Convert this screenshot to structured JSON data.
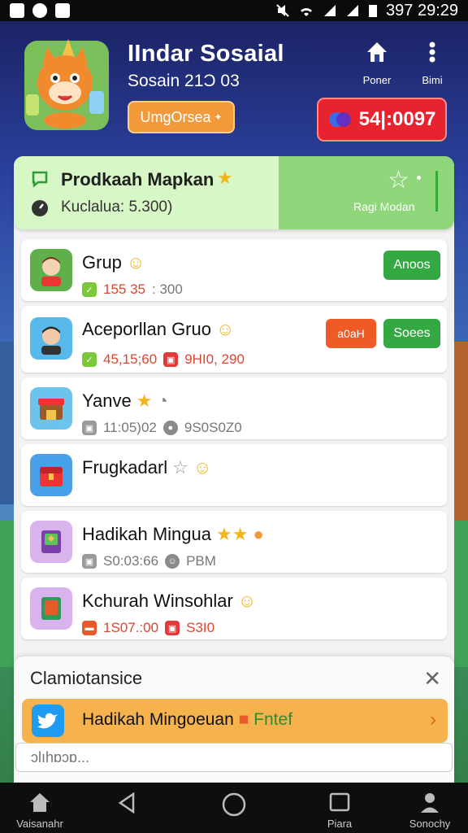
{
  "status_bar": {
    "time": "397 29:29"
  },
  "header": {
    "title": "IIndar Sosaial",
    "subtitle": "Sosain 21Ͻ 03",
    "promo_button": "UmgOrsea",
    "nav_home_label": "Poner",
    "nav_menu_label": "Bimi",
    "score": "54|:0097"
  },
  "featured": {
    "title": "Prodkaah Mapkan",
    "subtitle": "Kuclalua: 5.300)",
    "right_label": "Ragi Modan"
  },
  "rows": [
    {
      "name": "Grup",
      "meta1": "155 35",
      "meta2": ": 300",
      "button": "Anoos",
      "button2": ""
    },
    {
      "name": "Aceporllan Gruo",
      "meta1": "45,15;60",
      "meta2": "9HI0, 290",
      "button": "Soees",
      "button2": "a0aH"
    },
    {
      "name": "Yanve",
      "meta1": "11:05)02",
      "meta2": "9S0S0Z0",
      "button": "",
      "button2": ""
    },
    {
      "name": "Frugkadarl",
      "meta1": "",
      "meta2": "",
      "button": "",
      "button2": ""
    },
    {
      "name": "Hadikah Mingua",
      "meta1": "S0:03:66",
      "meta2": "PBM",
      "button": "",
      "button2": ""
    },
    {
      "name": "Kchurah Winsohlar",
      "meta1": "1S07.:00",
      "meta2": "S3I0",
      "button": "",
      "button2": ""
    }
  ],
  "popup": {
    "title": "Clamiotansice",
    "bar_label": "Hadikah Mingoeuan",
    "bar_accent": "Fntef",
    "input_placeholder": "ↄlıhɒɔɒ..."
  },
  "bottom_nav": {
    "home_label": "Vaisanahr",
    "files_label": "Piara",
    "profile_label": "Sonochy"
  },
  "colors": {
    "accent_green": "#34a843",
    "score_red": "#e8232f",
    "promo_orange": "#f29a3a",
    "popup_bar": "#f6b24d"
  }
}
